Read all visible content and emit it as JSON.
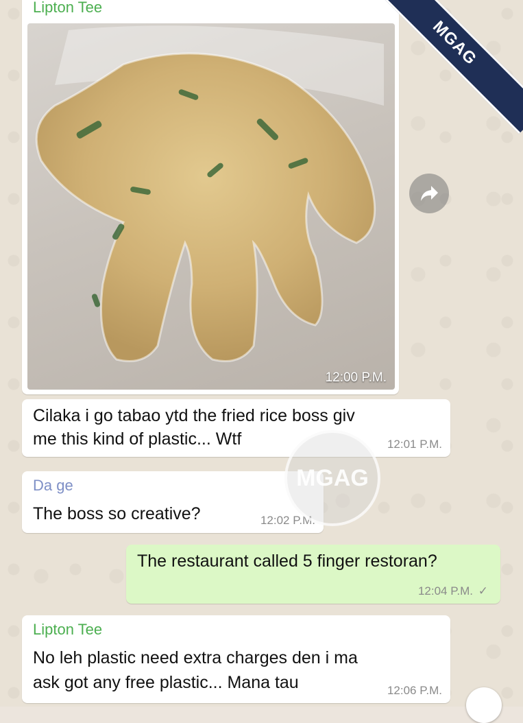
{
  "watermark": {
    "corner_text": "MGAG",
    "center_text": "MGAG"
  },
  "messages": [
    {
      "sender": "Lipton Tee",
      "type": "image",
      "image_alt": "fried rice packed in a plastic glove",
      "time": "12:00 P.M."
    },
    {
      "sender": "",
      "type": "text",
      "lines": [
        "Cilaka i go tabao ytd the fried rice boss giv",
        "me this kind of plastic... Wtf"
      ],
      "time": "12:01 P.M."
    },
    {
      "sender": "Da ge",
      "type": "text",
      "lines": [
        "The boss so creative?"
      ],
      "time": "12:02 P.M."
    },
    {
      "sender": "",
      "type": "text",
      "outgoing": true,
      "lines": [
        "The restaurant called 5 finger restoran?"
      ],
      "time": "12:04 P.M.",
      "status": "✓"
    },
    {
      "sender": "Lipton Tee",
      "type": "text",
      "lines": [
        "No leh plastic need extra charges den i ma",
        "ask got any free plastic... Mana tau"
      ],
      "time": "12:06 P.M."
    }
  ],
  "colors": {
    "sender_lipton": "#4caf50",
    "sender_dage": "#7e8fc6",
    "outgoing_bubble": "#dcf8c6",
    "ribbon": "#1f2f56"
  }
}
